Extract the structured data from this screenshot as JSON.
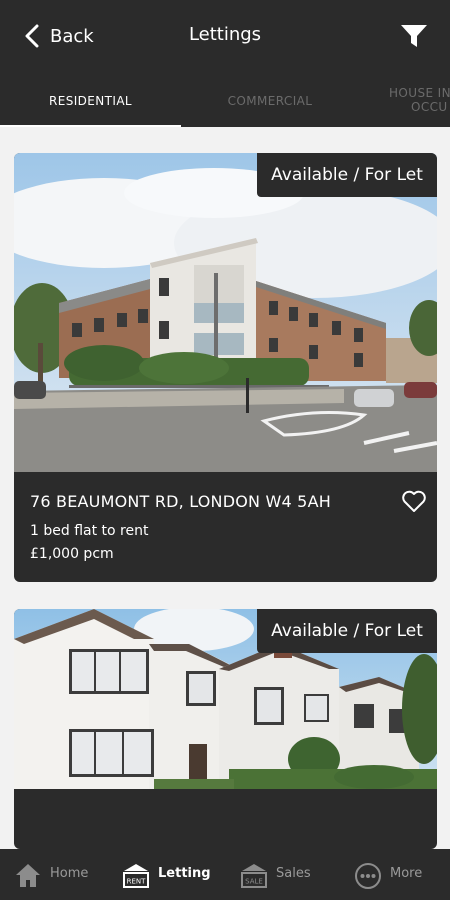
{
  "header": {
    "back_label": "Back",
    "title": "Lettings",
    "filter_icon": "filter-funnel-icon"
  },
  "tabs": [
    {
      "label": "RESIDENTIAL",
      "active": true
    },
    {
      "label": "COMMERCIAL",
      "active": false
    },
    {
      "label": "HOUSE IN",
      "label_line2": "OCCU",
      "active": false
    }
  ],
  "listings": [
    {
      "badge": "Available / For Let",
      "address": "76 BEAUMONT RD, LONDON W4 5AH",
      "description": "1 bed flat to rent",
      "price": "£1,000 pcm"
    },
    {
      "badge": "Available / For Let"
    }
  ],
  "bottom_nav": [
    {
      "label": "Home",
      "icon": "home-icon",
      "active": false
    },
    {
      "label": "Letting",
      "icon": "rent-sign-icon",
      "icon_text": "RENT",
      "active": true
    },
    {
      "label": "Sales",
      "icon": "sale-sign-icon",
      "icon_text": "SALE",
      "active": false
    },
    {
      "label": "More",
      "icon": "more-dots-icon",
      "active": false
    }
  ],
  "colors": {
    "bar_background": "#2b2b2b",
    "page_background": "#f2f2f2",
    "inactive_text": "#6b6b6b"
  }
}
